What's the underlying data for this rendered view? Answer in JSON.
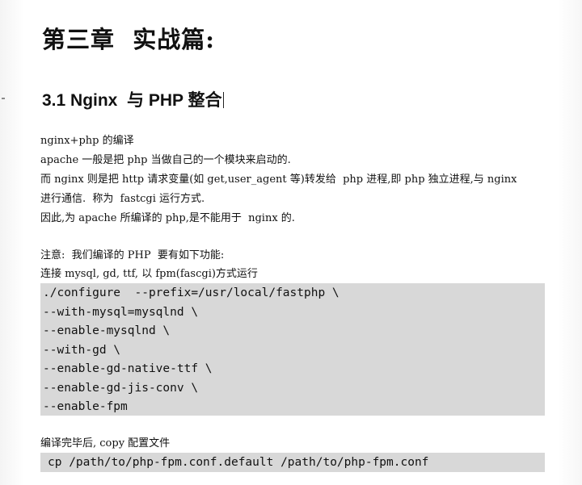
{
  "chapter_title": "第三章  实战篇:",
  "section_title": "3.1 Nginx  与 PHP 整合",
  "intro_lines": [
    "nginx+php 的编译",
    "apache 一般是把 php 当做自己的一个模块来启动的.",
    "而 nginx 则是把 http 请求变量(如 get,user_agent 等)转发给  php 进程,即 php 独立进程,与 nginx",
    "进行通信.  称为  fastcgi 运行方式.",
    "因此,为 apache 所编译的 php,是不能用于  nginx 的."
  ],
  "note_lines": [
    "注意:  我们编译的 PHP  要有如下功能:",
    "连接 mysql, gd, ttf, 以 fpm(fascgi)方式运行"
  ],
  "configure_lines": [
    "./configure  --prefix=/usr/local/fastphp \\",
    "--with-mysql=mysqlnd \\",
    "--enable-mysqlnd \\",
    "--with-gd \\",
    "--enable-gd-native-ttf \\",
    "--enable-gd-jis-conv \\",
    "--enable-fpm"
  ],
  "after_compile_line": "编译完毕后, copy 配置文件",
  "copy_command": "cp /path/to/php-fpm.conf.default /path/to/php-fpm.conf"
}
